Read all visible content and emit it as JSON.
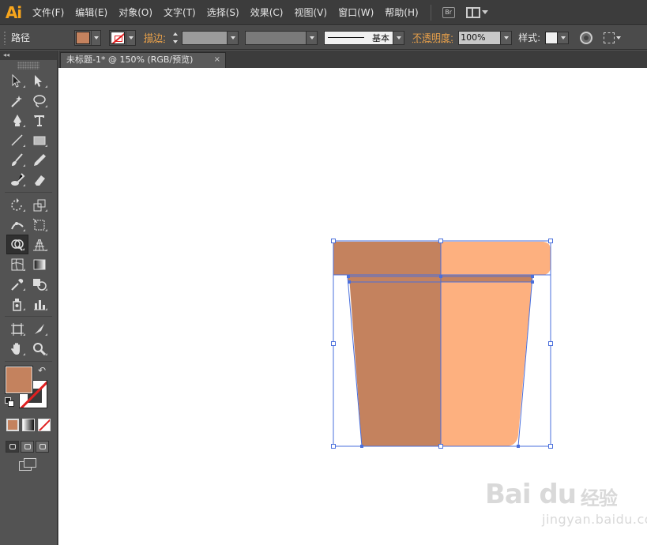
{
  "app": {
    "logo": "Ai",
    "menus": [
      "文件(F)",
      "编辑(E)",
      "对象(O)",
      "文字(T)",
      "选择(S)",
      "效果(C)",
      "视图(V)",
      "窗口(W)",
      "帮助(H)"
    ],
    "bridge_label": "Br"
  },
  "control_bar": {
    "selection_type": "路径",
    "fill_color": "#c4825e",
    "stroke_label": "描边:",
    "stroke_profile": "基本",
    "opacity_label": "不透明度:",
    "opacity_value": "100%",
    "style_label": "样式:"
  },
  "tools": [
    [
      "selection-tool-icon",
      "direct-selection-tool-icon"
    ],
    [
      "magic-wand-tool-icon",
      "lasso-tool-icon"
    ],
    [
      "pen-tool-icon",
      "type-tool-icon"
    ],
    [
      "line-segment-tool-icon",
      "rectangle-tool-icon"
    ],
    [
      "paintbrush-tool-icon",
      "pencil-tool-icon"
    ],
    [
      "blob-brush-tool-icon",
      "eraser-tool-icon"
    ],
    [
      "rotate-tool-icon",
      "scale-tool-icon"
    ],
    [
      "width-tool-icon",
      "free-transform-tool-icon"
    ],
    [
      "shape-builder-tool-icon",
      "perspective-grid-tool-icon"
    ],
    [
      "mesh-tool-icon",
      "gradient-tool-icon"
    ],
    [
      "eyedropper-tool-icon",
      "blend-tool-icon"
    ],
    [
      "symbol-sprayer-tool-icon",
      "column-graph-tool-icon"
    ],
    [
      "artboard-tool-icon",
      "slice-tool-icon"
    ],
    [
      "hand-tool-icon",
      "zoom-tool-icon"
    ]
  ],
  "document": {
    "tab_title": "未标题-1* @ 150% (RGB/预览)",
    "close_glyph": "×"
  },
  "artwork": {
    "dark_color": "#c4825e",
    "light_color": "#fdb07f",
    "selection_color": "#4a6fdc"
  },
  "watermark": {
    "main": "Bai du",
    "cn": "经验",
    "url": "jingyan.baidu.com"
  },
  "colors": {
    "accent_orange": "#e8a04a",
    "menubar_bg": "#3c3c3c",
    "panel_bg": "#535353"
  }
}
